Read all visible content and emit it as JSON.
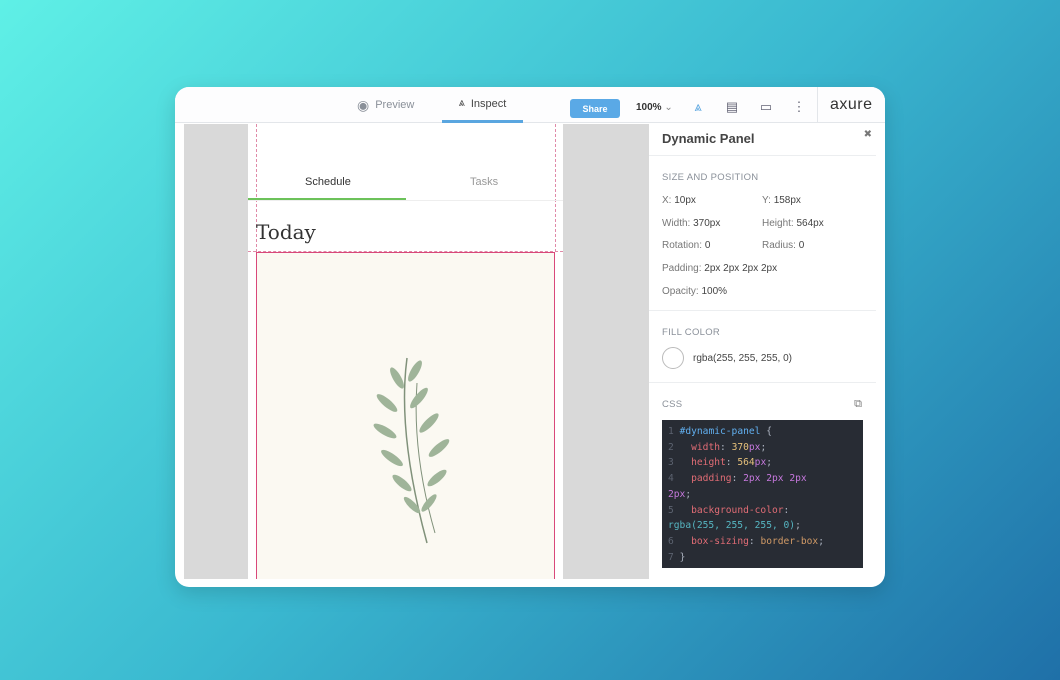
{
  "toolbar": {
    "preview": "Preview",
    "inspect": "Inspect",
    "share": "Share",
    "zoom": "100%",
    "logo": "axure"
  },
  "phone": {
    "tabs": [
      "Schedule",
      "Tasks"
    ],
    "heading": "Today"
  },
  "panel": {
    "title": "Dynamic Panel",
    "size_section": "SIZE AND POSITION",
    "props": [
      {
        "k": "X:",
        "v": "10px"
      },
      {
        "k": "Y:",
        "v": "158px"
      },
      {
        "k": "Width:",
        "v": "370px"
      },
      {
        "k": "Height:",
        "v": "564px"
      },
      {
        "k": "Rotation:",
        "v": "0"
      },
      {
        "k": "Radius:",
        "v": "0"
      },
      {
        "k": "Padding:",
        "v": "2px 2px 2px 2px"
      },
      {
        "k": "Opacity:",
        "v": "100%"
      }
    ],
    "fill_section": "FILL COLOR",
    "fill_value": "rgba(255, 255, 255, 0)",
    "css_section": "CSS",
    "css": {
      "selector": "#dynamic-panel",
      "width": "370",
      "height": "564",
      "padding": "2px 2px 2px",
      "padding2": "2px",
      "bg": "rgba(255, 255, 255, 0)",
      "boxsizing": "border-box"
    }
  }
}
